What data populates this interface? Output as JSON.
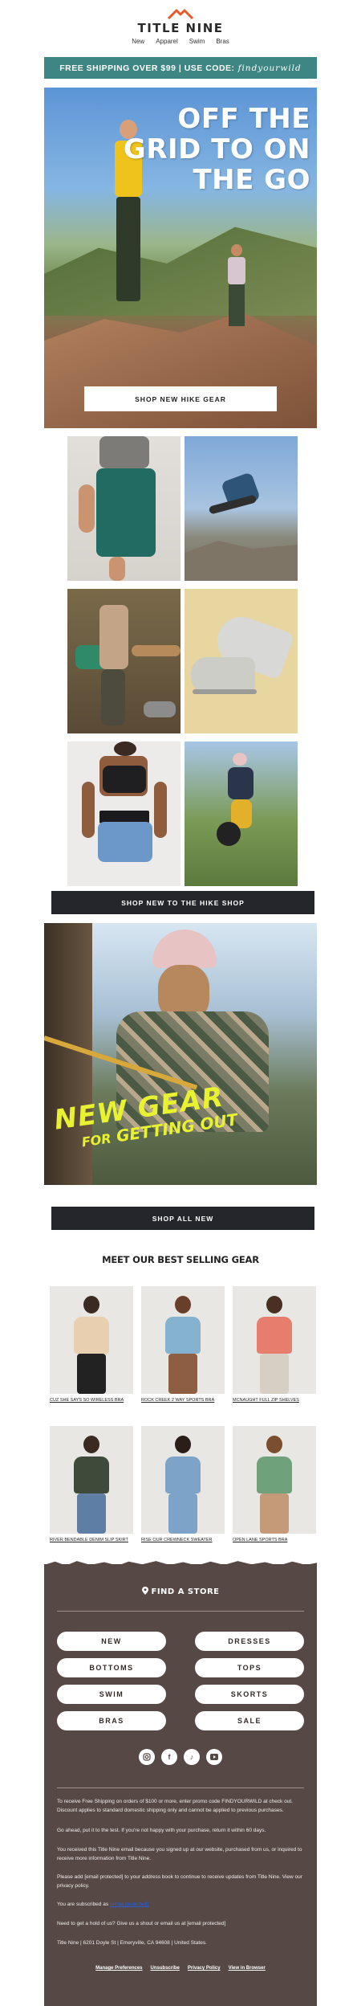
{
  "brand": {
    "name": "TITLE NINE",
    "logo_color": "#e85a2a"
  },
  "nav": {
    "items": [
      "New",
      "Apparel",
      "Swim",
      "Bras"
    ]
  },
  "promo": {
    "text": "FREE SHIPPING OVER $99 | USE CODE:",
    "code": "findyourwild",
    "color": "#3e8683"
  },
  "hero": {
    "headline": "OFF THE\nGRID TO ON\nTHE GO",
    "button": "SHOP NEW HIKE GEAR"
  },
  "hike_grid": {
    "tiles": [
      "hiker-pants-tile",
      "jumping-hiker-tile",
      "camp-table-tile",
      "hiking-shoes-tile",
      "sports-bra-shorts-tile",
      "trail-runner-tile"
    ]
  },
  "hike_shop_button": "SHOP NEW TO THE HIKE SHOP",
  "gear_feature": {
    "headline_line1": "NEW GEAR",
    "headline_for": "FOR",
    "headline_line2": "GETTING OUT"
  },
  "shop_all_button": "SHOP ALL NEW",
  "best_sellers": {
    "title": "MEET OUR BEST SELLING GEAR",
    "products": [
      {
        "name": "CUZ SHE SAYS SO WIRELESS BRA"
      },
      {
        "name": "ROCK CREEK 2 WAY SPORTS BRA"
      },
      {
        "name": "MCNAUGHT FULL ZIP SHELVES"
      },
      {
        "name": "RIVER BENDABLE DENIM SLIP SKIRT"
      },
      {
        "name": "RISE OUR CREWNECK SWEATER"
      },
      {
        "name": "OPEN LANE SPORTS BRA"
      }
    ]
  },
  "footer": {
    "find_store": "FIND A STORE",
    "categories": [
      "NEW",
      "DRESSES",
      "BOTTOMS",
      "TOPS",
      "SWIM",
      "SKORTS",
      "BRAS",
      "SALE"
    ],
    "social": [
      "instagram-icon",
      "facebook-icon",
      "tiktok-icon",
      "youtube-icon"
    ],
    "disclaimer1": "To receive Free Shipping on orders of $100 or more, enter promo code FINDYOURWILD at check out. Discount applies to standard domestic shipping only and cannot be applied to previous purchases.",
    "disclaimer2": "Go ahead, put it to the test. If you're not happy with your purchase, return it within 60 days.",
    "disclaimer3": "You received this Title Nine email because you signed up at our website, purchased from us, or inquired to receive more information from Title Nine.",
    "disclaimer4": "Please add [email protected] to your address book to continue to receive updates from Title Nine. View our privacy policy.",
    "subscribed_prefix": "You are subscribed as",
    "subscribed_email": "[email protected]",
    "help": "Need to get a hold of us? Give us a shout or email us at [email protected]",
    "address": "Title Nine | 6201 Doyle St | Emeryville, CA 94608 | United States.",
    "links": [
      "Manage Preferences",
      "Unsubscribe",
      "Privacy Policy",
      "View in Browser"
    ],
    "bg_color": "#554845"
  }
}
